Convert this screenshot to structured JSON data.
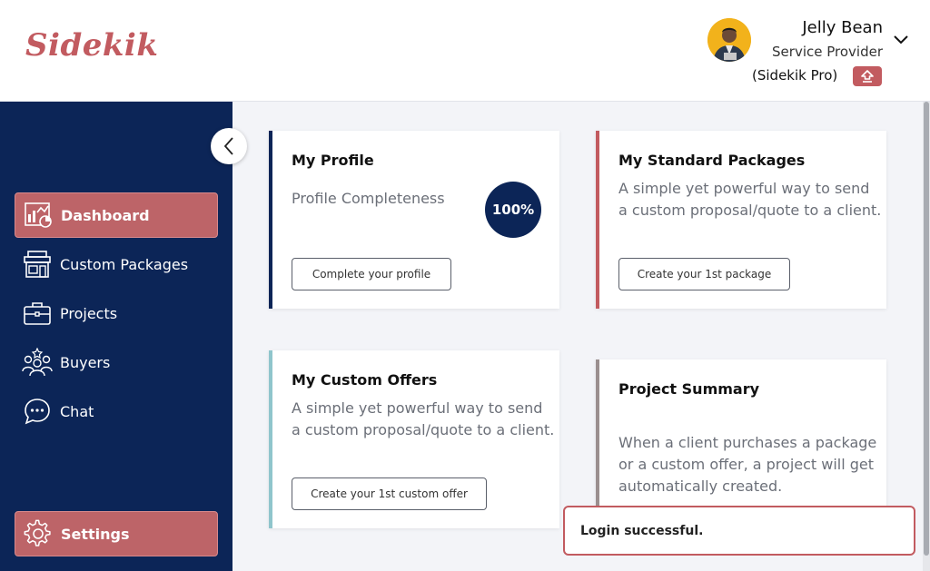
{
  "app": {
    "logo": "Sidekik"
  },
  "user": {
    "name": "Jelly Bean",
    "role": "Service Provider",
    "plan": "(Sidekik Pro)"
  },
  "sidebar": {
    "items": [
      {
        "label": "Dashboard",
        "icon": "dashboard-icon",
        "active": true
      },
      {
        "label": "Custom Packages",
        "icon": "store-icon"
      },
      {
        "label": "Projects",
        "icon": "briefcase-icon"
      },
      {
        "label": "Buyers",
        "icon": "users-group-icon"
      },
      {
        "label": "Chat",
        "icon": "chat-bubble-icon"
      }
    ],
    "settings": {
      "label": "Settings",
      "icon": "gear-icon"
    }
  },
  "cards": {
    "profile": {
      "title": "My Profile",
      "desc": "Profile Completeness",
      "progress": "100%",
      "button": "Complete your profile"
    },
    "standard": {
      "title": "My Standard Packages",
      "desc": "A simple yet powerful way to send a custom proposal/quote to a client.",
      "button": "Create your 1st package"
    },
    "custom": {
      "title": "My Custom Offers",
      "desc": "A simple yet powerful way to send a custom proposal/quote to a client.",
      "button": "Create your 1st custom offer"
    },
    "summary": {
      "title": "Project Summary",
      "desc": "When a client purchases a package or a custom offer, a project will get automatically created."
    }
  },
  "toast": {
    "message": "Login successful."
  },
  "colors": {
    "navy": "#0c2557",
    "accent": "#c25b60",
    "teal": "#8fc5cc",
    "gray_bar": "#9a8f8f"
  }
}
